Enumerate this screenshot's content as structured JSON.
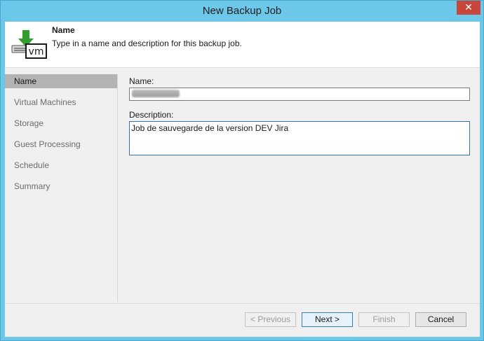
{
  "window": {
    "title": "New Backup Job",
    "close_label": "✕"
  },
  "header": {
    "title": "Name",
    "description": "Type in a name and description for this backup job.",
    "icon_text": "vm"
  },
  "sidebar": {
    "items": [
      {
        "label": "Name",
        "selected": true
      },
      {
        "label": "Virtual Machines",
        "selected": false
      },
      {
        "label": "Storage",
        "selected": false
      },
      {
        "label": "Guest Processing",
        "selected": false
      },
      {
        "label": "Schedule",
        "selected": false
      },
      {
        "label": "Summary",
        "selected": false
      }
    ]
  },
  "form": {
    "name_label": "Name:",
    "name_value": "",
    "description_label": "Description:",
    "description_value": "Job de sauvegarde de la version DEV Jira"
  },
  "buttons": {
    "previous": "< Previous",
    "next": "Next >",
    "finish": "Finish",
    "cancel": "Cancel"
  },
  "colors": {
    "window_frame": "#6cc7e9",
    "close_button": "#c7463b",
    "selected_nav": "#b3b3b3",
    "focus_border": "#3c6fb6"
  }
}
